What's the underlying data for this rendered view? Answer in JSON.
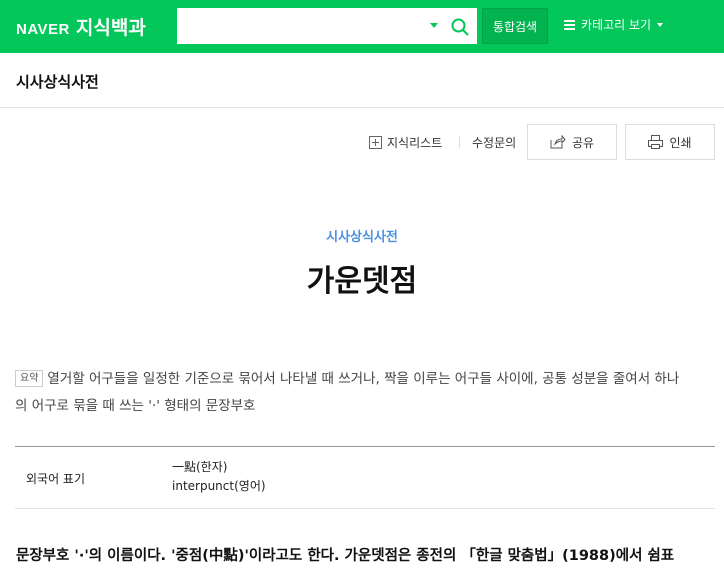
{
  "header": {
    "brand": "NAVER",
    "service": "지식백과",
    "search": {
      "value": "",
      "placeholder": ""
    },
    "total_search_label": "통합검색",
    "category_label": "카테고리 보기"
  },
  "subheader": {
    "title": "시사상식사전"
  },
  "actions": {
    "knowledge_list": "지식리스트",
    "edit_request": "수정문의",
    "share": "공유",
    "print": "인쇄"
  },
  "article": {
    "category": "시사상식사전",
    "title": "가운뎃점",
    "summary_badge": "요약",
    "summary_line1": "열거할 어구들을 일정한 기준으로 묶어서 나타낼 때 쓰거나, 짝을 이루는 어구들 사이에, 공통 성분을 줄여서 하나",
    "summary_line2": "의 어구로 묶을 때 쓰는 '·' 형태의 문장부호",
    "info": {
      "label": "외국어 표기",
      "values": [
        "一點(한자)",
        "interpunct(영어)"
      ]
    },
    "body_text": "문장부호 '·'의 이름이다. '중점(中點)'이라고도 한다. 가운뎃점은 종전의 「한글 맞춤법」(1988)에서 쉼표"
  },
  "colors": {
    "brand_green": "#03c75a",
    "category_blue": "#4a90e2"
  },
  "icons": [
    "search-icon",
    "dropdown-caret-icon",
    "list-icon",
    "chevron-down-icon",
    "plus-box-icon",
    "share-icon",
    "print-icon"
  ]
}
